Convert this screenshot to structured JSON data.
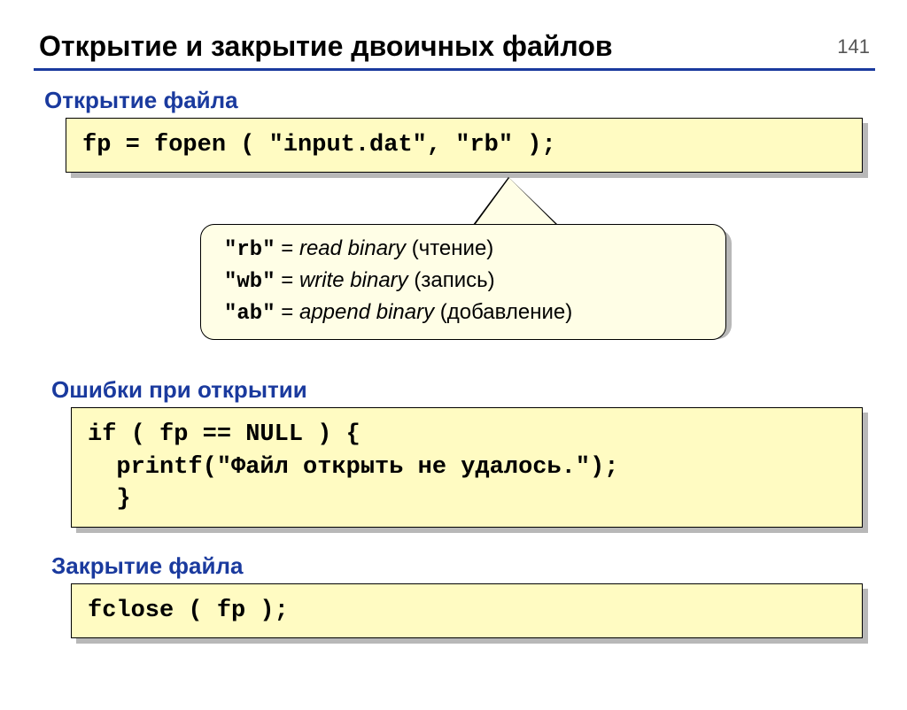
{
  "page_number": "141",
  "title": "Открытие и закрытие двоичных файлов",
  "sections": {
    "open": {
      "heading": "Открытие файла",
      "code": "fp = fopen ( \"input.dat\", \"rb\" );"
    },
    "callout": {
      "rb_code": "\"rb\"",
      "rb_eq": " = ",
      "rb_desc": "read binary",
      "rb_ru": " (чтение)",
      "wb_code": "\"wb\"",
      "wb_eq": " = ",
      "wb_desc": "write binary",
      "wb_ru": " (запись)",
      "ab_code": "\"ab\"",
      "ab_eq": " = ",
      "ab_desc": "append binary",
      "ab_ru": " (добавление)"
    },
    "errors": {
      "heading": "Ошибки при открытии",
      "code": "if ( fp == NULL ) {\n  printf(\"Файл открыть не удалось.\");\n  }"
    },
    "close": {
      "heading": "Закрытие файла",
      "code": "fclose ( fp );"
    }
  }
}
